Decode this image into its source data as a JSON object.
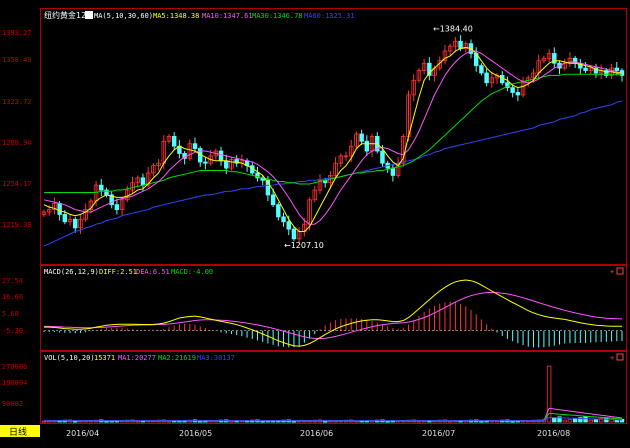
{
  "instrument": {
    "name": "纽约黄金12",
    "icon": "ma-toggle-icon"
  },
  "price_panel": {
    "ma_title": "MA(5,10,30,60)",
    "ma5": "MA5:1348.38",
    "ma10": "MA10:1347.61",
    "ma30": "MA30:1346.78",
    "ma60": "MA60:1325.31",
    "y_labels": [
      "1393.27",
      "1358.49",
      "1323.72",
      "1288.94",
      "1254.17",
      "1219.39"
    ],
    "annotation_high": "1384.40",
    "annotation_low": "1207.10"
  },
  "macd_panel": {
    "title": "MACD(26,12,9)",
    "diff": "DIFF:2.51",
    "dea": "DEA:6.51",
    "macd": "MACD:-4.00",
    "y_labels": [
      "27.54",
      "16.66",
      "5.68",
      "-5.30"
    ]
  },
  "vol_panel": {
    "title": "VOL(5,10,20)",
    "value": "15371",
    "ma1": "MA1:20277",
    "ma2": "MA2:21619",
    "ma3": "MA3:30137",
    "y_labels": [
      "270006",
      "180004",
      "90002"
    ]
  },
  "footer": {
    "tab": "日线",
    "dates": [
      "2016/04",
      "2016/05",
      "2016/06",
      "2016/07",
      "2016/08"
    ]
  },
  "colors": {
    "up": "#ff3232",
    "down": "#54ffff",
    "ma5": "#ffff00",
    "ma10": "#ff55ff",
    "ma30": "#00dd00",
    "ma60": "#3344ff",
    "axis": "#b00000",
    "label": "#c00000",
    "white": "#ffffff"
  },
  "chart_data": {
    "type": "candlestick",
    "y_range": [
      1193,
      1398
    ],
    "x_labels": [
      "2016/04",
      "2016/05",
      "2016/06",
      "2016/07",
      "2016/08"
    ],
    "annotations": [
      {
        "text": "1384.40",
        "value": 1384.4
      },
      {
        "text": "1207.10",
        "value": 1207.1
      }
    ],
    "closes": [
      1234,
      1236,
      1241,
      1232,
      1226,
      1228,
      1221,
      1228,
      1236,
      1243,
      1256,
      1252,
      1248,
      1240,
      1236,
      1244,
      1252,
      1258,
      1262,
      1256,
      1266,
      1272,
      1274,
      1292,
      1296,
      1288,
      1282,
      1278,
      1290,
      1286,
      1275,
      1274,
      1280,
      1284,
      1276,
      1270,
      1277,
      1274,
      1276,
      1272,
      1266,
      1262,
      1260,
      1248,
      1240,
      1230,
      1226,
      1220,
      1212,
      1218,
      1224,
      1244,
      1252,
      1260,
      1258,
      1264,
      1274,
      1280,
      1280,
      1288,
      1298,
      1292,
      1284,
      1296,
      1284,
      1274,
      1270,
      1264,
      1274,
      1296,
      1330,
      1342,
      1350,
      1356,
      1346,
      1352,
      1358,
      1366,
      1370,
      1374,
      1368,
      1372,
      1364,
      1354,
      1348,
      1340,
      1344,
      1346,
      1340,
      1336,
      1332,
      1330,
      1340,
      1344,
      1348,
      1358,
      1360,
      1364,
      1356,
      1352,
      1356,
      1360,
      1356,
      1352,
      1350,
      1352,
      1348,
      1350,
      1346,
      1352,
      1350,
      1346
    ],
    "ma5": [
      1240,
      1238,
      1237,
      1235,
      1234,
      1232,
      1231,
      1232,
      1234,
      1237,
      1243,
      1246,
      1248,
      1247,
      1246,
      1246,
      1247,
      1249,
      1252,
      1253,
      1257,
      1262,
      1266,
      1274,
      1280,
      1285,
      1288,
      1286,
      1285,
      1284,
      1281,
      1279,
      1277,
      1276,
      1276,
      1276,
      1275,
      1275,
      1274,
      1272,
      1270,
      1267,
      1264,
      1258,
      1252,
      1244,
      1236,
      1228,
      1222,
      1218,
      1218,
      1222,
      1230,
      1238,
      1246,
      1254,
      1262,
      1268,
      1272,
      1278,
      1286,
      1290,
      1290,
      1290,
      1290,
      1286,
      1280,
      1275,
      1272,
      1278,
      1296,
      1312,
      1328,
      1342,
      1348,
      1352,
      1356,
      1360,
      1362,
      1366,
      1368,
      1369,
      1368,
      1364,
      1358,
      1352,
      1348,
      1346,
      1344,
      1342,
      1338,
      1336,
      1337,
      1339,
      1342,
      1348,
      1352,
      1356,
      1358,
      1358,
      1357,
      1356,
      1356,
      1355,
      1354,
      1353,
      1351,
      1350,
      1349,
      1349,
      1348,
      1348
    ],
    "ma10": [
      1244,
      1243,
      1242,
      1241,
      1240,
      1238,
      1236,
      1235,
      1234,
      1234,
      1236,
      1238,
      1240,
      1242,
      1244,
      1245,
      1246,
      1247,
      1249,
      1251,
      1253,
      1256,
      1259,
      1263,
      1268,
      1272,
      1276,
      1279,
      1281,
      1283,
      1284,
      1284,
      1283,
      1282,
      1281,
      1280,
      1279,
      1278,
      1277,
      1276,
      1275,
      1273,
      1270,
      1267,
      1263,
      1258,
      1252,
      1246,
      1239,
      1232,
      1227,
      1224,
      1224,
      1227,
      1232,
      1238,
      1245,
      1252,
      1258,
      1264,
      1270,
      1276,
      1281,
      1284,
      1286,
      1287,
      1286,
      1284,
      1282,
      1281,
      1285,
      1292,
      1300,
      1310,
      1320,
      1330,
      1338,
      1346,
      1352,
      1357,
      1361,
      1364,
      1366,
      1366,
      1364,
      1361,
      1358,
      1355,
      1352,
      1349,
      1346,
      1343,
      1341,
      1340,
      1341,
      1343,
      1346,
      1349,
      1352,
      1354,
      1356,
      1357,
      1357,
      1356,
      1355,
      1354,
      1353,
      1352,
      1351,
      1350,
      1349,
      1348
    ],
    "ma30": [
      1250,
      1250,
      1250,
      1250,
      1250,
      1250,
      1250,
      1250,
      1250,
      1250,
      1250,
      1251,
      1251,
      1251,
      1252,
      1252,
      1253,
      1254,
      1255,
      1256,
      1257,
      1258,
      1259,
      1260,
      1262,
      1263,
      1264,
      1265,
      1266,
      1267,
      1268,
      1268,
      1268,
      1268,
      1268,
      1268,
      1267,
      1267,
      1266,
      1265,
      1264,
      1263,
      1262,
      1261,
      1260,
      1259,
      1259,
      1258,
      1258,
      1257,
      1257,
      1257,
      1258,
      1259,
      1260,
      1261,
      1262,
      1263,
      1264,
      1265,
      1266,
      1266,
      1267,
      1267,
      1268,
      1268,
      1269,
      1270,
      1271,
      1272,
      1274,
      1276,
      1279,
      1282,
      1285,
      1289,
      1293,
      1297,
      1301,
      1305,
      1309,
      1313,
      1317,
      1321,
      1325,
      1328,
      1331,
      1333,
      1335,
      1337,
      1339,
      1340,
      1341,
      1342,
      1343,
      1344,
      1345,
      1346,
      1346,
      1346,
      1347,
      1347,
      1347,
      1347,
      1347,
      1347,
      1347,
      1347,
      1347,
      1347,
      1347,
      1347
    ],
    "ma60": [
      1206,
      1208,
      1210,
      1212,
      1214,
      1216,
      1218,
      1219,
      1221,
      1222,
      1224,
      1225,
      1227,
      1228,
      1229,
      1231,
      1232,
      1233,
      1234,
      1235,
      1236,
      1238,
      1239,
      1240,
      1241,
      1242,
      1243,
      1244,
      1245,
      1246,
      1247,
      1248,
      1248,
      1249,
      1250,
      1251,
      1251,
      1252,
      1253,
      1253,
      1254,
      1255,
      1255,
      1256,
      1256,
      1257,
      1257,
      1258,
      1258,
      1259,
      1259,
      1260,
      1260,
      1261,
      1261,
      1262,
      1262,
      1263,
      1264,
      1265,
      1266,
      1267,
      1268,
      1269,
      1270,
      1271,
      1272,
      1273,
      1274,
      1275,
      1276,
      1277,
      1278,
      1280,
      1281,
      1283,
      1284,
      1286,
      1287,
      1288,
      1289,
      1290,
      1291,
      1292,
      1293,
      1294,
      1295,
      1296,
      1297,
      1298,
      1299,
      1300,
      1301,
      1302,
      1303,
      1305,
      1306,
      1307,
      1308,
      1310,
      1311,
      1312,
      1313,
      1315,
      1316,
      1318,
      1319,
      1320,
      1321,
      1322,
      1324,
      1325
    ],
    "macd": {
      "y_range": [
        -10,
        30
      ],
      "diff": [
        2,
        2,
        1.8,
        1.5,
        1.2,
        1,
        0.8,
        0.8,
        1,
        1.4,
        2,
        2.5,
        3,
        3.3,
        3.5,
        3.6,
        3.6,
        3.6,
        3.5,
        3.4,
        3.4,
        3.5,
        3.7,
        4.2,
        5,
        6,
        7,
        7.5,
        7.8,
        8,
        7.6,
        7,
        6.4,
        5.8,
        5.2,
        4.6,
        4,
        3.3,
        2.5,
        1.5,
        0.5,
        -0.6,
        -1.8,
        -3,
        -4.2,
        -5.5,
        -6.5,
        -7.5,
        -8.2,
        -8.5,
        -8,
        -7,
        -5.5,
        -3.8,
        -2,
        -0.5,
        1,
        2.2,
        3.2,
        4,
        4.8,
        5.4,
        5.8,
        6,
        6,
        5.8,
        5.4,
        5,
        5,
        5.6,
        7.2,
        9.5,
        12,
        14.5,
        17,
        19.5,
        21.8,
        23.8,
        25.5,
        26.8,
        27.5,
        27.8,
        27.4,
        26.5,
        25,
        23.4,
        21.8,
        20.2,
        18.6,
        17,
        15.5,
        14,
        12.5,
        11,
        9.8,
        8.8,
        8,
        7.4,
        7,
        6.6,
        6.2,
        5.6,
        5,
        4.4,
        3.8,
        3.4,
        3,
        2.8,
        2.6,
        2.5,
        2.5,
        2.51
      ],
      "dea": [
        2.5,
        2.4,
        2.3,
        2.2,
        2,
        1.9,
        1.8,
        1.7,
        1.6,
        1.6,
        1.7,
        1.8,
        2,
        2.2,
        2.4,
        2.6,
        2.8,
        3,
        3.1,
        3.2,
        3.2,
        3.3,
        3.4,
        3.5,
        3.7,
        4,
        4.4,
        4.8,
        5.2,
        5.6,
        5.9,
        6,
        6,
        5.9,
        5.8,
        5.6,
        5.3,
        5,
        4.6,
        4.2,
        3.7,
        3.2,
        2.6,
        2,
        1.3,
        0.6,
        -0.2,
        -1,
        -1.8,
        -2.6,
        -3.3,
        -3.9,
        -4.2,
        -4.3,
        -4.1,
        -3.7,
        -3.1,
        -2.4,
        -1.6,
        -0.8,
        0,
        0.8,
        1.5,
        2.2,
        2.8,
        3.3,
        3.7,
        4,
        4.2,
        4.4,
        4.8,
        5.4,
        6.2,
        7.2,
        8.4,
        9.8,
        11.2,
        12.7,
        14.2,
        15.7,
        17,
        18.2,
        19.2,
        20,
        20.6,
        20.9,
        21,
        20.9,
        20.6,
        20.2,
        19.6,
        18.9,
        18.1,
        17.2,
        16.3,
        15.4,
        14.5,
        13.6,
        12.8,
        12,
        11.2,
        10.5,
        9.8,
        9.2,
        8.6,
        8,
        7.5,
        7.2,
        6.9,
        6.7,
        6.6,
        6.51
      ]
    },
    "volume": {
      "y_range": [
        0,
        290000
      ],
      "spike_index": 97,
      "spike_value": 270006
    }
  }
}
